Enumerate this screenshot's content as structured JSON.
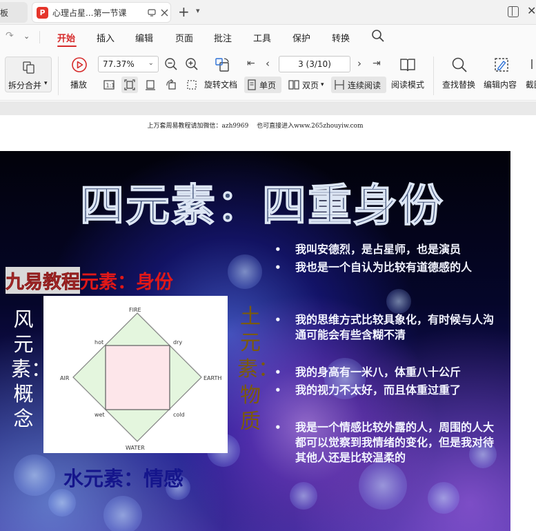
{
  "tabs": {
    "previous_tab_label": "板",
    "active_tab_title": "心理占星...第一节课",
    "app_badge": "P"
  },
  "menu": {
    "items": [
      "开始",
      "插入",
      "编辑",
      "页面",
      "批注",
      "工具",
      "保护",
      "转换"
    ],
    "active": "开始"
  },
  "toolbar": {
    "split_merge_label": "拆分合并",
    "play_label": "播放",
    "zoom_value": "77.37%",
    "page_value": "3 (3/10)",
    "rotate_label": "旋转文档",
    "single_page_label": "单页",
    "double_page_label": "双页",
    "continuous_label": "连续阅读",
    "reading_mode_label": "阅读模式",
    "find_replace_label": "查找替换",
    "edit_content_label": "编辑内容",
    "screenshot_label": "截图"
  },
  "document": {
    "header_note": "上万套周易教程请加微信：azh9969　 也可直接进入www.265zhouyiw.com",
    "slide": {
      "title": "四元素：四重身份",
      "watermark_text": "九易教程",
      "fire_heading_tail": "元素：身份",
      "air_heading": "风元素：概念",
      "earth_heading": "土元素：物质",
      "water_heading": "水元素：情感",
      "diagram_labels": {
        "fire": "FIRE",
        "water": "WATER",
        "air": "AIR",
        "earth": "EARTH",
        "hot": "hot",
        "dry": "dry",
        "wet": "wet",
        "cold": "cold"
      },
      "bullets": [
        "我叫安德烈，是占星师，也是演员",
        "我也是一个自认为比较有道德感的人",
        "我的思维方式比较具象化，有时候与人沟通可能会有些含糊不清",
        "我的身高有一米八，体重八十公斤",
        "我的视力不太好，而且体重过重了",
        "我是一个情感比较外露的人，周围的人大都可以觉察到我情绪的变化，但是我对待其他人还是比较温柔的"
      ]
    }
  },
  "colors": {
    "accent_red": "#d62a2a",
    "fire_red": "#e01818",
    "earth_brown": "#7b5a0c",
    "water_blue": "#15158c",
    "diagram_square_fill": "#fde6ea",
    "diagram_diamond_fill": "#e4f6de"
  }
}
